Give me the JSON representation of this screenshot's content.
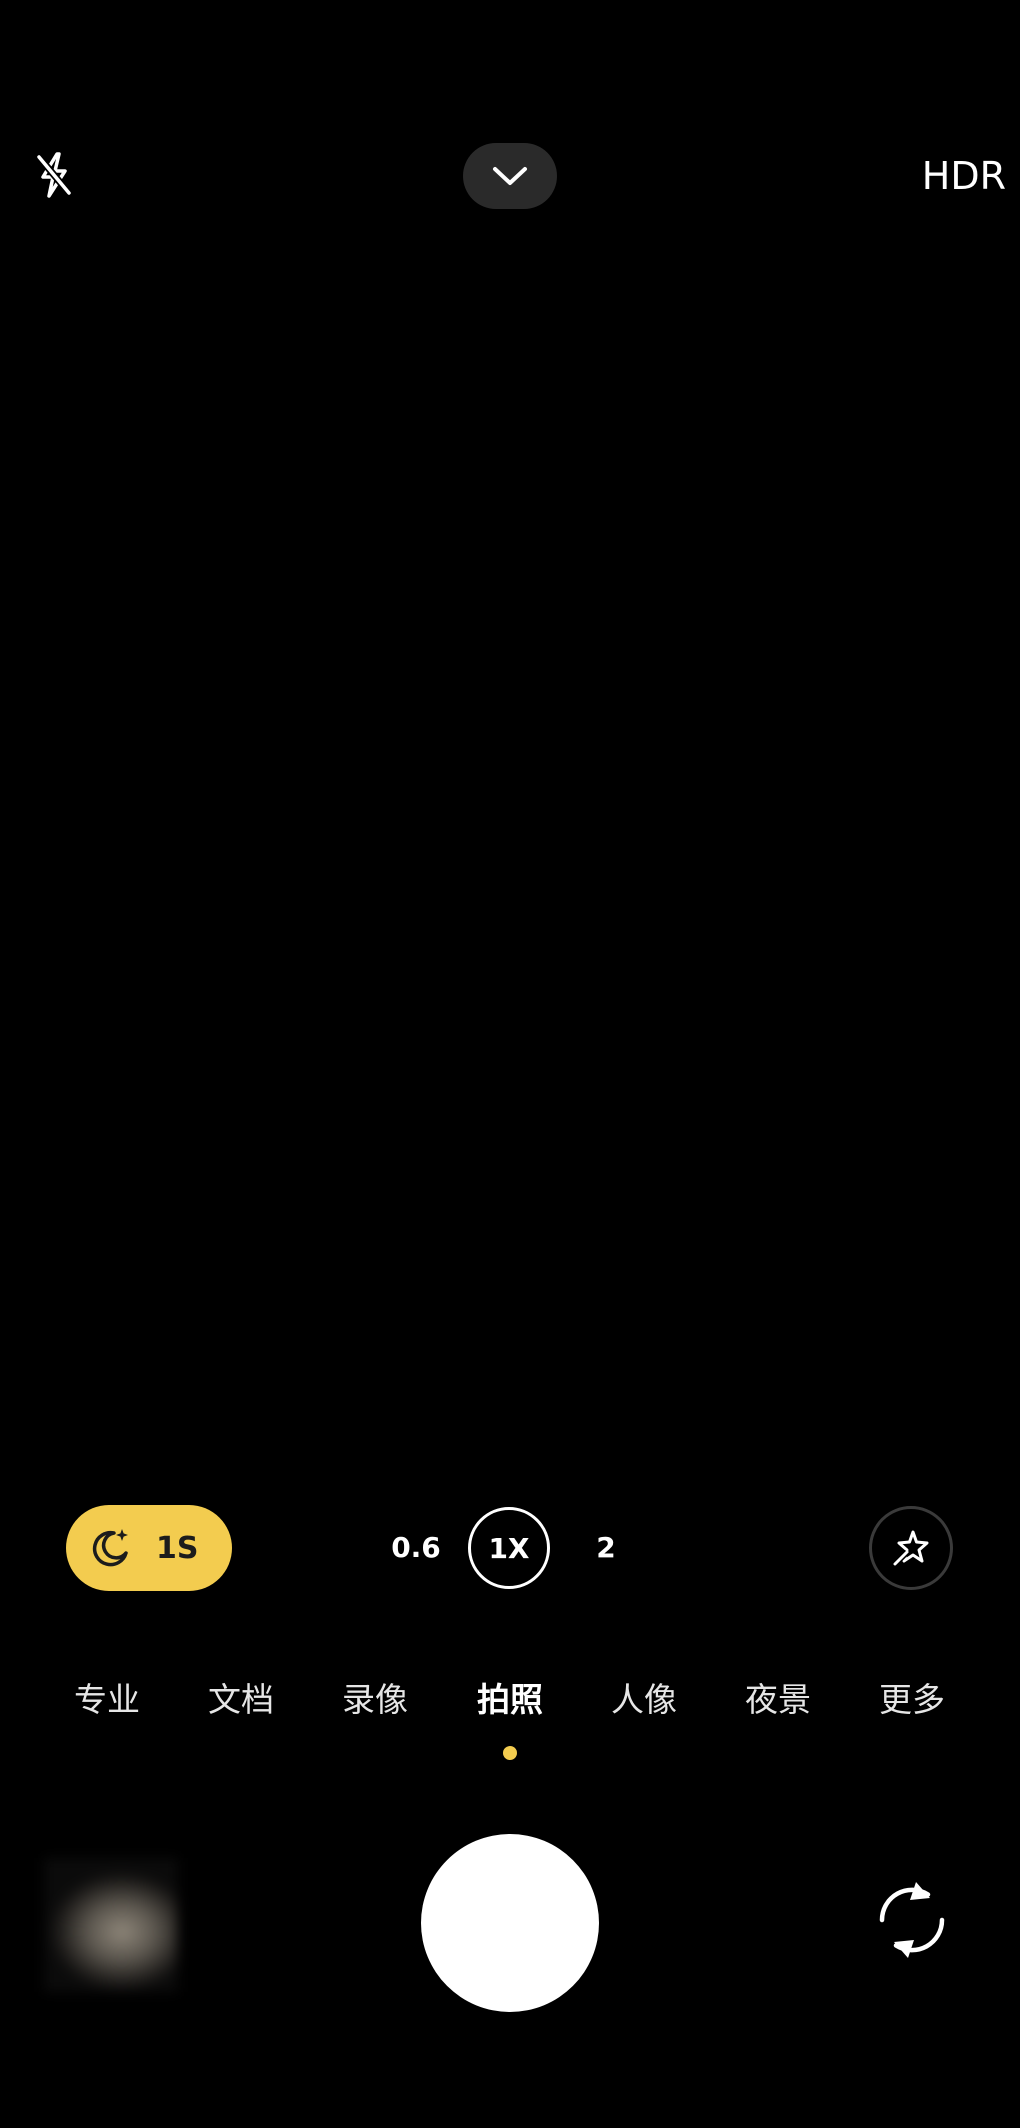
{
  "top_bar": {
    "flash_icon": "flash-off-icon",
    "collapse_icon": "chevron-down-icon",
    "hdr_label": "HDR"
  },
  "zoom": {
    "night_label": "1S",
    "night_icon": "moon-icon",
    "options": [
      "0.6",
      "1X",
      "2"
    ],
    "selected": "1X",
    "beauty_icon": "beauty-star-icon"
  },
  "modes": {
    "items": [
      "专业",
      "文档",
      "录像",
      "拍照",
      "人像",
      "夜景",
      "更多"
    ],
    "active": "拍照"
  },
  "bottom": {
    "shutter_icon": "shutter-button",
    "switch_icon": "camera-switch-icon",
    "gallery_icon": "gallery-thumbnail"
  },
  "colors": {
    "accent": "#f3cc4f",
    "background": "#000000",
    "pill_bg": "#2a2a2a"
  }
}
